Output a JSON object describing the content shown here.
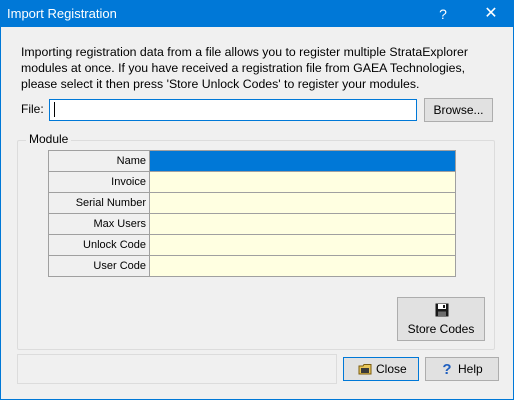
{
  "titlebar": {
    "title": "Import Registration",
    "help_glyph": "?",
    "close_glyph": "✕"
  },
  "description": "Importing registration data from a file allows you to register multiple StrataExplorer modules at once. If you have received a registration file from GAEA Technologies, please select it then press 'Store Unlock Codes' to register your modules.",
  "file": {
    "label": "File:",
    "value": "",
    "browse_label": "Browse..."
  },
  "module_group": {
    "label": "Module",
    "rows": [
      {
        "label": "Name",
        "value": ""
      },
      {
        "label": "Invoice",
        "value": ""
      },
      {
        "label": "Serial Number",
        "value": ""
      },
      {
        "label": "Max Users",
        "value": ""
      },
      {
        "label": "Unlock Code",
        "value": ""
      },
      {
        "label": "User Code",
        "value": ""
      }
    ],
    "selected_row": "Name",
    "store_button": {
      "label": "Store Codes",
      "icon": "floppy-disk-icon"
    }
  },
  "footer": {
    "close_label": "Close",
    "close_icon": "folder-icon",
    "help_label": "Help",
    "help_icon": "question-icon"
  },
  "colors": {
    "accent": "#0078d7",
    "grid_cell": "#ffffe1",
    "window_bg": "#f0f0f0"
  }
}
